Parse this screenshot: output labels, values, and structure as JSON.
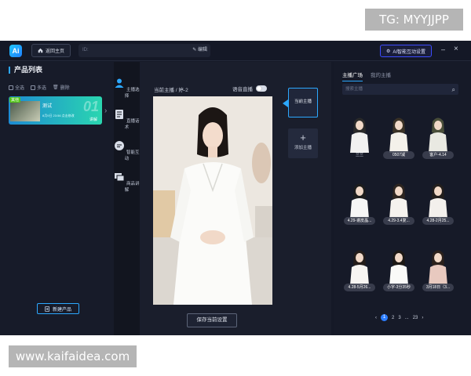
{
  "watermarks": {
    "top_right": "TG: MYYJJPP",
    "bottom_left": "www.kaifaidea.com"
  },
  "titlebar": {
    "logo": "Ai",
    "home_label": "返回主页",
    "id_placeholder": "ID:",
    "edit_label": "编辑",
    "ai_button_label": "AI智能互动设置",
    "minimize": "–",
    "close": "×"
  },
  "left_panel": {
    "title": "产品列表",
    "actions": {
      "select_all": "全选",
      "multi_select": "多选",
      "delete": "删除"
    },
    "product": {
      "tag": "其他",
      "name": "测试",
      "subtitle": "8月9日 23:56 点击修改",
      "number": "01",
      "link": "讲解"
    },
    "new_product": "新建产品"
  },
  "rail": {
    "items": [
      {
        "label": "主播选择",
        "icon": "person-icon"
      },
      {
        "label": "直播话术",
        "icon": "document-icon"
      },
      {
        "label": "智能互动",
        "icon": "chat-icon"
      },
      {
        "label": "商品讲解",
        "icon": "cards-icon"
      }
    ]
  },
  "center": {
    "current_anchor": "当前主播 / 婷-2",
    "voice_live": "语音直播",
    "save_button": "保存当前设置",
    "side_current": "当前主播",
    "add_anchor_plus": "+",
    "add_anchor": "添加主播"
  },
  "right_panel": {
    "tabs": [
      "主播广场",
      "我的主播"
    ],
    "search_placeholder": "搜索主播",
    "anchors": [
      {
        "caption": "兰兰"
      },
      {
        "caption": "0507减"
      },
      {
        "caption": "客户-4.14"
      },
      {
        "caption": "4.29-谢皮晶..."
      },
      {
        "caption": "4.29-3.4复..."
      },
      {
        "caption": "4.28-2月25..."
      },
      {
        "caption": "4.28-5月26..."
      },
      {
        "caption": "小字-3分35秒"
      },
      {
        "caption": "3月18日（3..."
      }
    ],
    "pager": {
      "prev": "‹",
      "pages": [
        "1",
        "2",
        "3"
      ],
      "ellipsis": "...",
      "last": "23",
      "next": "›"
    }
  },
  "colors": {
    "accent": "#2ca8ff",
    "background": "#151927",
    "card_gradient_start": "#1e8bd2",
    "card_gradient_end": "#2ad6b0"
  }
}
